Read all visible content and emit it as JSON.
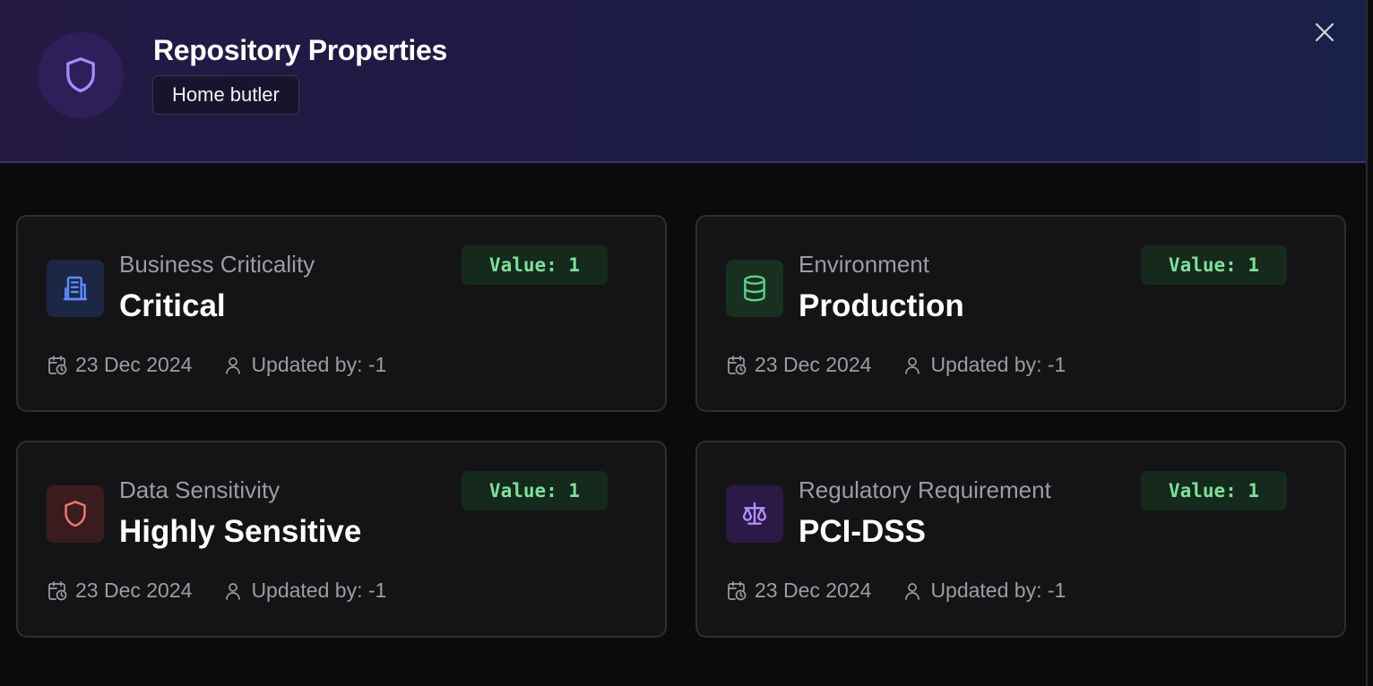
{
  "header": {
    "title": "Repository Properties",
    "repo_tag": "Home butler",
    "icon": "shield-icon",
    "close_icon": "close-icon"
  },
  "colors": {
    "accent_purple": "#a78bfa",
    "badge_green": "#7be29a",
    "critical_blue": "#5b8dff",
    "environment_green": "#5fd08a",
    "sensitivity_red": "#f0776e",
    "regulatory_purple": "#b58cff"
  },
  "properties": [
    {
      "label": "Business Criticality",
      "value": "Critical",
      "badge": "Value: 1",
      "date": "23 Dec 2024",
      "updated_by": "Updated by: -1",
      "icon": "building-icon"
    },
    {
      "label": "Environment",
      "value": "Production",
      "badge": "Value: 1",
      "date": "23 Dec 2024",
      "updated_by": "Updated by: -1",
      "icon": "database-icon"
    },
    {
      "label": "Data Sensitivity",
      "value": "Highly Sensitive",
      "badge": "Value: 1",
      "date": "23 Dec 2024",
      "updated_by": "Updated by: -1",
      "icon": "shield-icon"
    },
    {
      "label": "Regulatory Requirement",
      "value": "PCI-DSS",
      "badge": "Value: 1",
      "date": "23 Dec 2024",
      "updated_by": "Updated by: -1",
      "icon": "scale-icon"
    }
  ]
}
